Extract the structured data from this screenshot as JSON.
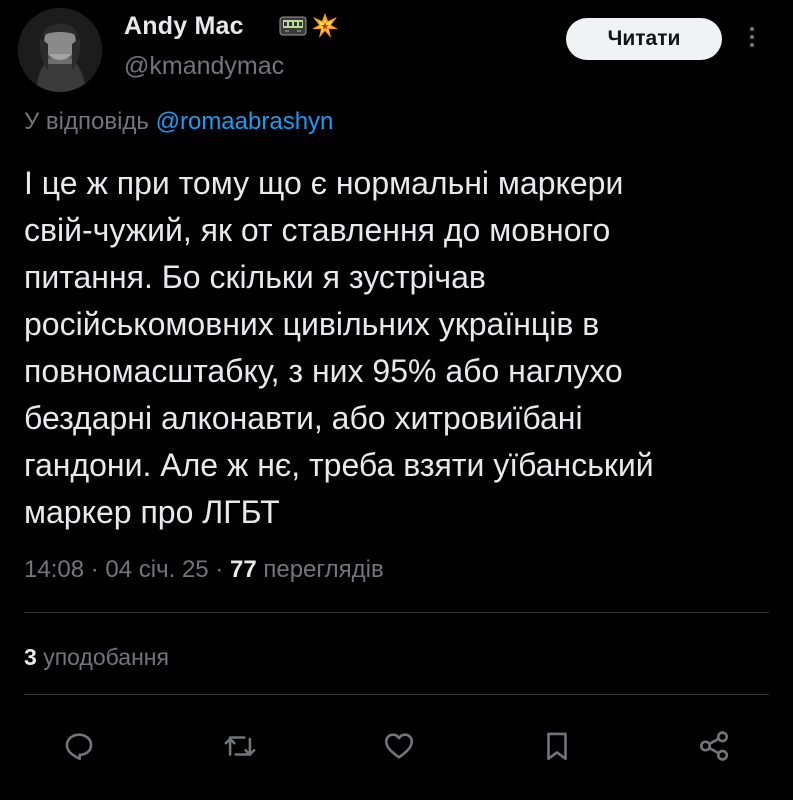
{
  "author": {
    "display_name": "Andy Mac",
    "handle": "@kmandymac",
    "badges": [
      "pager-emoji",
      "collision-emoji"
    ]
  },
  "follow_button": {
    "label": "Читати"
  },
  "reply": {
    "prefix": "У відповідь",
    "mention": "@romaabrashyn"
  },
  "tweet": {
    "text": "І це ж при тому що є нормальні маркери\nсвій-чужий, як от ставлення до мовного\nпитання. Бо скільки я зустрічав\nросійськомовних цивільних українців в\nповномасштабку, з них 95% або наглухо\nбездарні алконавти, або хитровиїбані\nгандони. Але ж нє, треба взяти уїбанський\nмаркер про ЛГБТ"
  },
  "meta": {
    "time": "14:08",
    "date": "04 січ. 25",
    "views_count": "77",
    "views_label": "переглядів",
    "separator": "·"
  },
  "likes": {
    "count": "3",
    "label": "уподобання"
  },
  "actions": [
    {
      "name": "reply",
      "icon": "reply-icon"
    },
    {
      "name": "retweet",
      "icon": "retweet-icon"
    },
    {
      "name": "like",
      "icon": "heart-icon"
    },
    {
      "name": "bookmark",
      "icon": "bookmark-icon"
    },
    {
      "name": "share",
      "icon": "share-icon"
    }
  ],
  "colors": {
    "background": "#000000",
    "text": "#e7e9ea",
    "secondary": "#71767b",
    "link": "#1d9bf0",
    "divider": "#2f3336",
    "button_bg": "#eff3f4"
  }
}
